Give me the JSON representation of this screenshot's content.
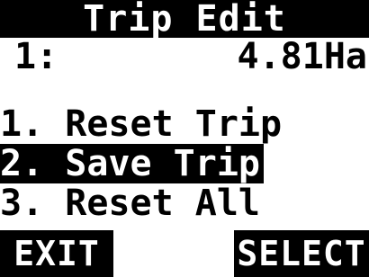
{
  "header": {
    "title": "Trip Edit"
  },
  "trip": {
    "index": "1:",
    "value": "4.81Ha"
  },
  "menu": {
    "items": [
      {
        "label": "1. Reset Trip",
        "selected": false
      },
      {
        "label": "2. Save Trip",
        "selected": true
      },
      {
        "label": "3. Reset All",
        "selected": false
      }
    ]
  },
  "softkeys": {
    "left_label": "EXIT",
    "right_label": "SELECT"
  },
  "colors": {
    "foreground": "#000000",
    "background": "#ffffff"
  }
}
